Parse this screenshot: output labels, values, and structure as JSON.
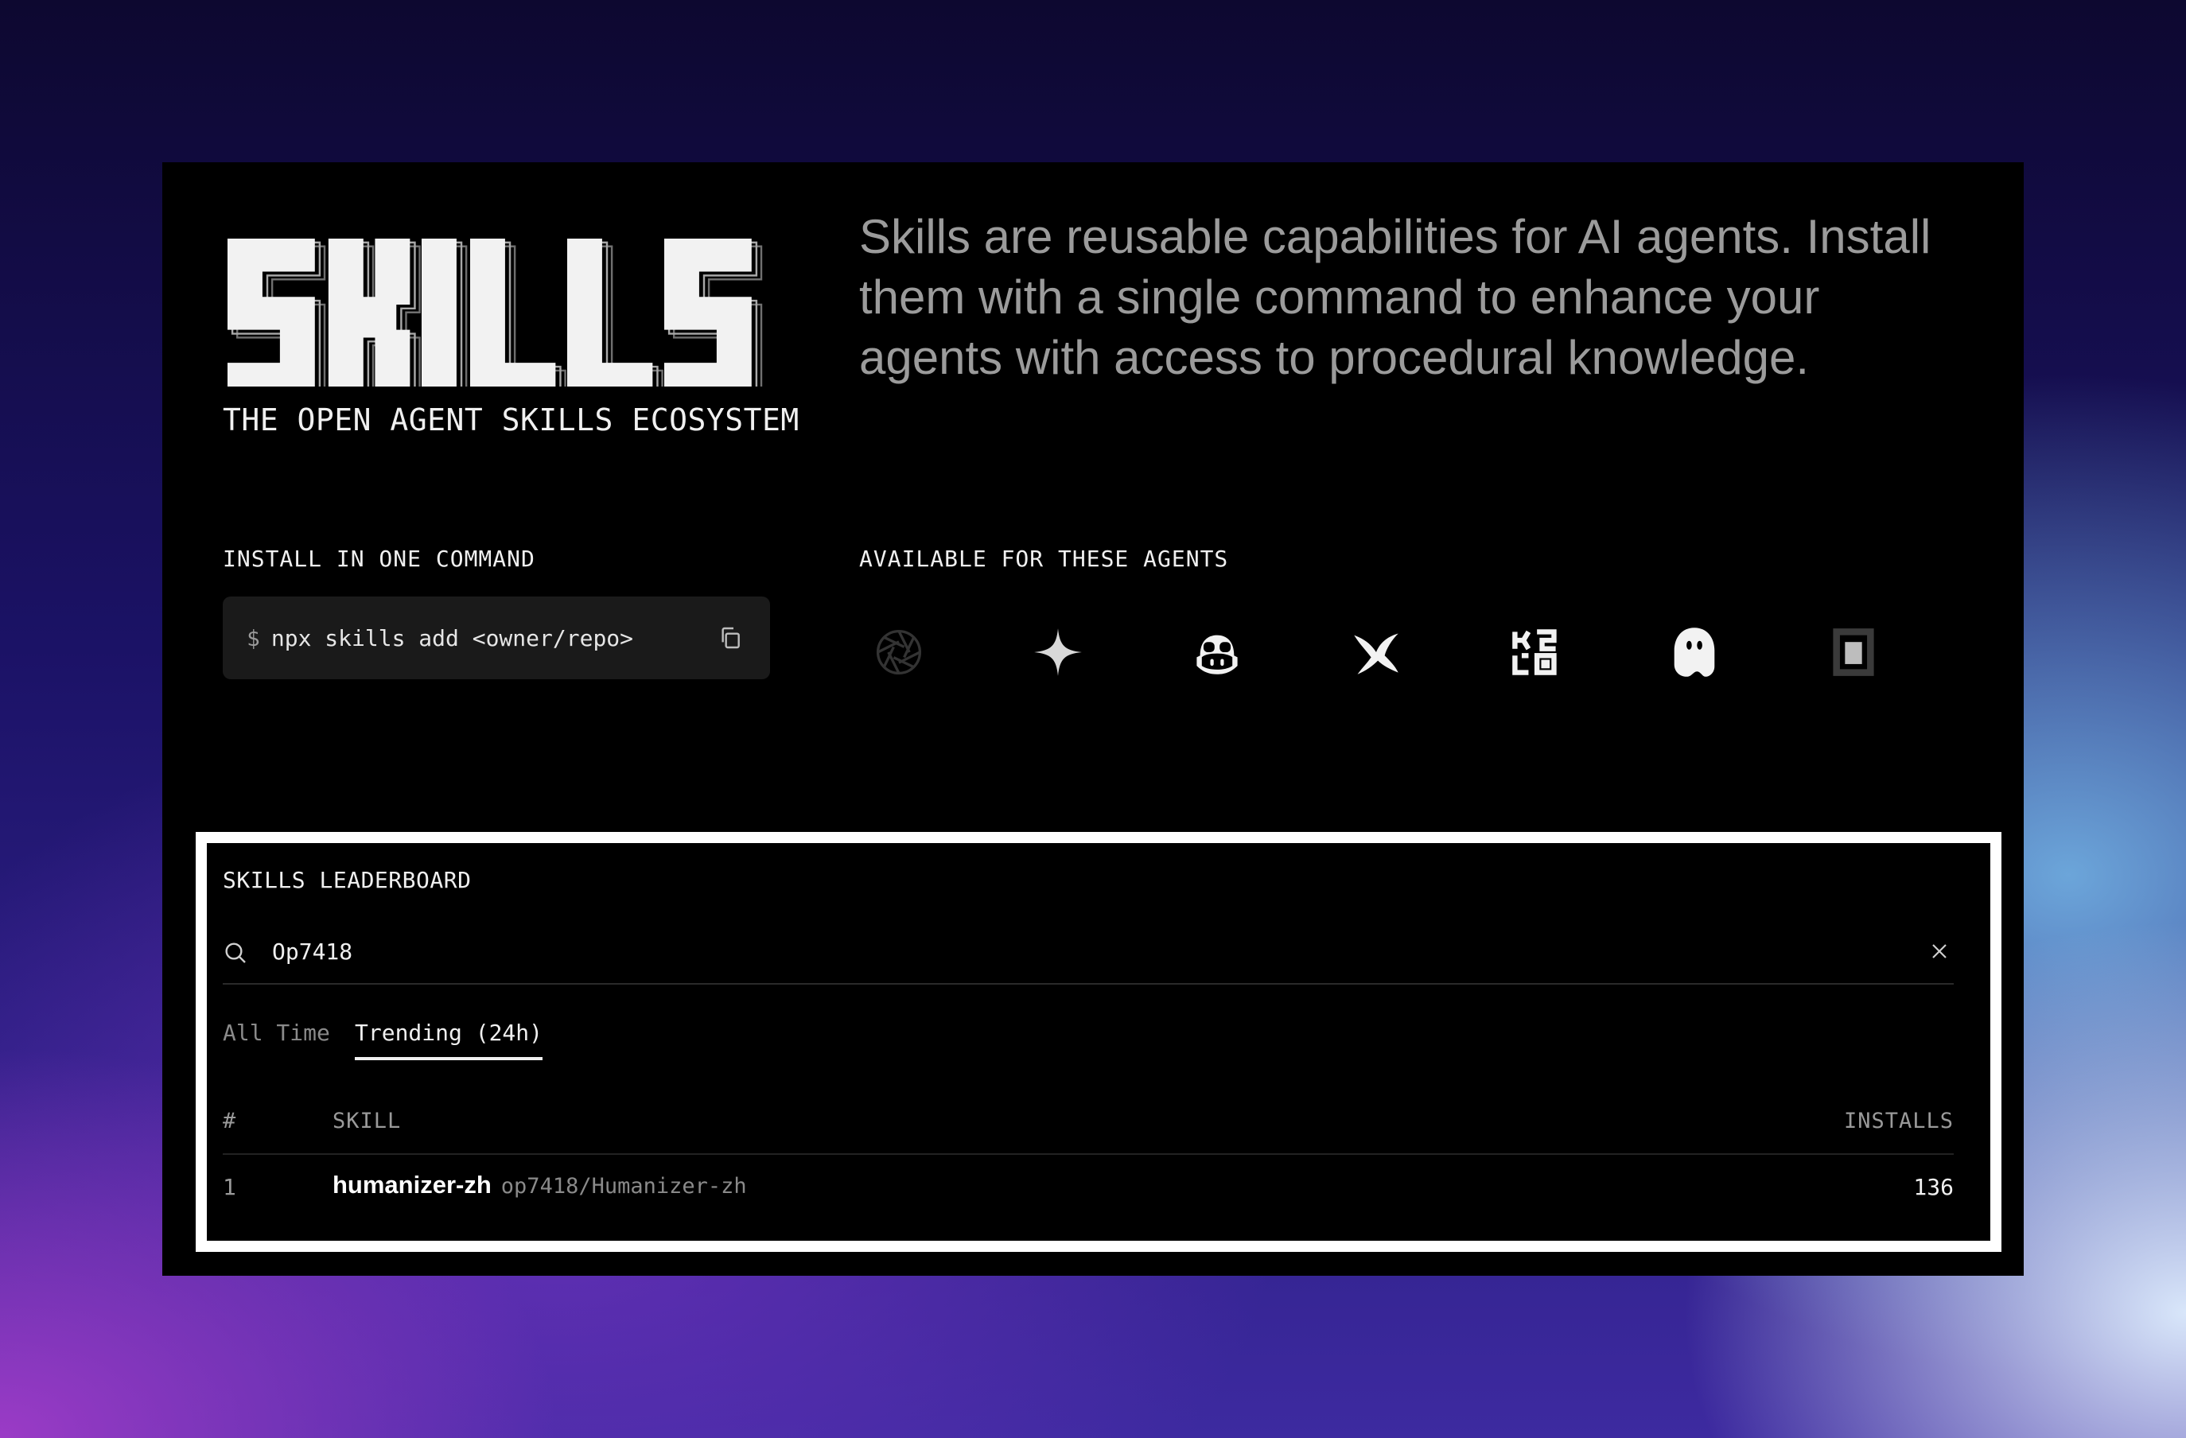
{
  "hero": {
    "logo_text": "SKILLS",
    "tagline": "THE OPEN AGENT SKILLS ECOSYSTEM",
    "intro": "Skills are reusable capabilities for AI agents. Install them with a single command to enhance your agents with access to procedural knowledge."
  },
  "install": {
    "label": "INSTALL IN ONE COMMAND",
    "prompt": "$",
    "command": "npx skills add <owner/repo>",
    "copy_icon": "copy-icon"
  },
  "agents": {
    "label": "AVAILABLE FOR THESE AGENTS",
    "icons": [
      "aperture-agent-icon",
      "sparkle-agent-icon",
      "copilot-agent-icon",
      "bird-agent-icon",
      "grid-logo-agent-icon",
      "ghost-agent-icon",
      "terminal-window-agent-icon"
    ]
  },
  "leaderboard": {
    "title": "SKILLS LEADERBOARD",
    "search": {
      "value": "Op7418",
      "icon": "search-icon",
      "clear_icon": "close-icon"
    },
    "tabs": [
      {
        "label": "All Time",
        "active": false
      },
      {
        "label": "Trending (24h)",
        "active": true
      }
    ],
    "columns": {
      "rank": "#",
      "skill": "SKILL",
      "installs": "INSTALLS"
    },
    "rows": [
      {
        "rank": "1",
        "name": "humanizer-zh",
        "repo": "op7418/Humanizer-zh",
        "installs": "136"
      }
    ]
  },
  "colors": {
    "card_bg": "#000000",
    "text_primary": "#f0f0f0",
    "text_muted": "#9b9b9b",
    "highlight_border": "#ffffff"
  }
}
